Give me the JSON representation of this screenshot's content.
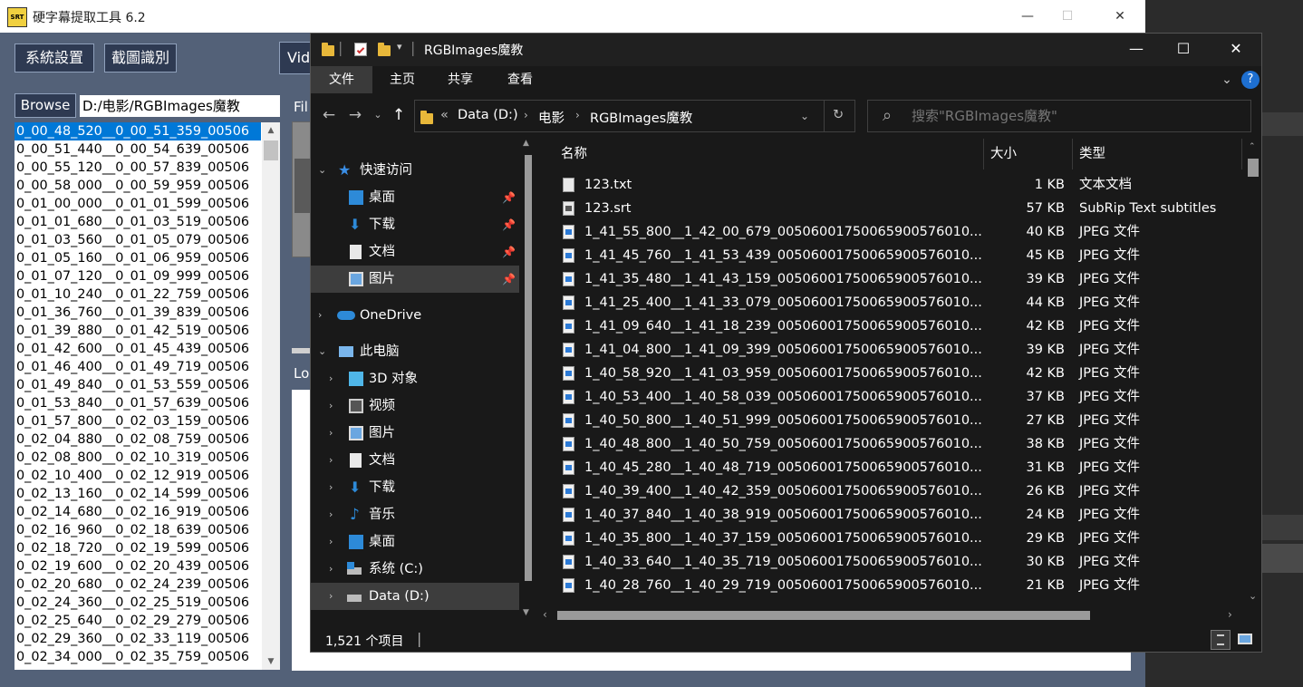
{
  "app": {
    "icon_text": "SRT",
    "title": "硬字幕提取工具 6.2",
    "minimize": "—",
    "maximize": "☐",
    "close": "✕",
    "settings_button": "系統設置",
    "screenshot_button": "截圖識別",
    "video_tab": "Vid",
    "browse_button": "Browse",
    "path_value": "D:/电影/RGBImages魔教",
    "file_label": "Fil",
    "log_label": "Lo",
    "files": [
      "0_00_48_520__0_00_51_359_00506",
      "0_00_51_440__0_00_54_639_00506",
      "0_00_55_120__0_00_57_839_00506",
      "0_00_58_000__0_00_59_959_00506",
      "0_01_00_000__0_01_01_599_00506",
      "0_01_01_680__0_01_03_519_00506",
      "0_01_03_560__0_01_05_079_00506",
      "0_01_05_160__0_01_06_959_00506",
      "0_01_07_120__0_01_09_999_00506",
      "0_01_10_240__0_01_22_759_00506",
      "0_01_36_760__0_01_39_839_00506",
      "0_01_39_880__0_01_42_519_00506",
      "0_01_42_600__0_01_45_439_00506",
      "0_01_46_400__0_01_49_719_00506",
      "0_01_49_840__0_01_53_559_00506",
      "0_01_53_840__0_01_57_639_00506",
      "0_01_57_800__0_02_03_159_00506",
      "0_02_04_880__0_02_08_759_00506",
      "0_02_08_800__0_02_10_319_00506",
      "0_02_10_400__0_02_12_919_00506",
      "0_02_13_160__0_02_14_599_00506",
      "0_02_14_680__0_02_16_919_00506",
      "0_02_16_960__0_02_18_639_00506",
      "0_02_18_720__0_02_19_599_00506",
      "0_02_19_600__0_02_20_439_00506",
      "0_02_20_680__0_02_24_239_00506",
      "0_02_24_360__0_02_25_519_00506",
      "0_02_25_640__0_02_29_279_00506",
      "0_02_29_360__0_02_33_119_00506",
      "0_02_34_000__0_02_35_759_00506"
    ]
  },
  "explorer": {
    "title": "RGBImages魔教",
    "quick_access_arrow": "▾",
    "minimize": "—",
    "maximize": "☐",
    "close": "✕",
    "ribbon": {
      "file": "文件",
      "home": "主页",
      "share": "共享",
      "view": "查看",
      "expand": "⌄",
      "help": "?"
    },
    "nav": {
      "back": "←",
      "forward": "→",
      "recent": "⌄",
      "up": "↑"
    },
    "address": {
      "overflow": "«",
      "drive": "Data (D:)",
      "folder1": "电影",
      "folder2": "RGBImages魔教",
      "sep": "›",
      "dropdown": "⌄",
      "refresh": "↻"
    },
    "search": {
      "icon": "⌕",
      "placeholder": "搜索\"RGBImages魔教\""
    },
    "nav_pane": {
      "quick_access": "快速访问",
      "desktop": "桌面",
      "downloads": "下载",
      "documents": "文档",
      "pictures": "图片",
      "onedrive": "OneDrive",
      "this_pc": "此电脑",
      "objects3d": "3D 对象",
      "videos": "视频",
      "pictures2": "图片",
      "documents2": "文档",
      "downloads2": "下载",
      "music": "音乐",
      "desktop2": "桌面",
      "system_c": "系统 (C:)",
      "data_d": "Data (D:)"
    },
    "columns": {
      "name": "名称",
      "size": "大小",
      "type": "类型"
    },
    "files": [
      {
        "name": "123.txt",
        "size": "1 KB",
        "type": "文本文档",
        "kind": "txt"
      },
      {
        "name": "123.srt",
        "size": "57 KB",
        "type": "SubRip Text subtitles",
        "kind": "srt"
      },
      {
        "name": "1_41_55_800__1_42_00_679_0050600175006590057601​0...",
        "size": "40 KB",
        "type": "JPEG 文件",
        "kind": "img"
      },
      {
        "name": "1_41_45_760__1_41_53_439_00506001750065900576010...",
        "size": "45 KB",
        "type": "JPEG 文件",
        "kind": "img"
      },
      {
        "name": "1_41_35_480__1_41_43_159_00506001750065900576010...",
        "size": "39 KB",
        "type": "JPEG 文件",
        "kind": "img"
      },
      {
        "name": "1_41_25_400__1_41_33_079_00506001750065900576010...",
        "size": "44 KB",
        "type": "JPEG 文件",
        "kind": "img"
      },
      {
        "name": "1_41_09_640__1_41_18_239_00506001750065900576010...",
        "size": "42 KB",
        "type": "JPEG 文件",
        "kind": "img"
      },
      {
        "name": "1_41_04_800__1_41_09_399_00506001750065900576010...",
        "size": "39 KB",
        "type": "JPEG 文件",
        "kind": "img"
      },
      {
        "name": "1_40_58_920__1_41_03_959_00506001750065900576010...",
        "size": "42 KB",
        "type": "JPEG 文件",
        "kind": "img"
      },
      {
        "name": "1_40_53_400__1_40_58_039_00506001750065900576010...",
        "size": "37 KB",
        "type": "JPEG 文件",
        "kind": "img"
      },
      {
        "name": "1_40_50_800__1_40_51_999_00506001750065900576010...",
        "size": "27 KB",
        "type": "JPEG 文件",
        "kind": "img"
      },
      {
        "name": "1_40_48_800__1_40_50_759_00506001750065900576010...",
        "size": "38 KB",
        "type": "JPEG 文件",
        "kind": "img"
      },
      {
        "name": "1_40_45_280__1_40_48_719_00506001750065900576010...",
        "size": "31 KB",
        "type": "JPEG 文件",
        "kind": "img"
      },
      {
        "name": "1_40_39_400__1_40_42_359_00506001750065900576010...",
        "size": "26 KB",
        "type": "JPEG 文件",
        "kind": "img"
      },
      {
        "name": "1_40_37_840__1_40_38_919_00506001750065900576010...",
        "size": "24 KB",
        "type": "JPEG 文件",
        "kind": "img"
      },
      {
        "name": "1_40_35_800__1_40_37_159_00506001750065900576010...",
        "size": "29 KB",
        "type": "JPEG 文件",
        "kind": "img"
      },
      {
        "name": "1_40_33_640__1_40_35_719_00506001750065900576010...",
        "size": "30 KB",
        "type": "JPEG 文件",
        "kind": "img"
      },
      {
        "name": "1_40_28_760__1_40_29_719_00506001750065900576010...",
        "size": "21 KB",
        "type": "JPEG 文件",
        "kind": "img"
      }
    ],
    "status": "1,521 个项目",
    "colors": {
      "background": "#191919",
      "selected": "#3d3d3d",
      "accent": "#0078d7"
    }
  }
}
